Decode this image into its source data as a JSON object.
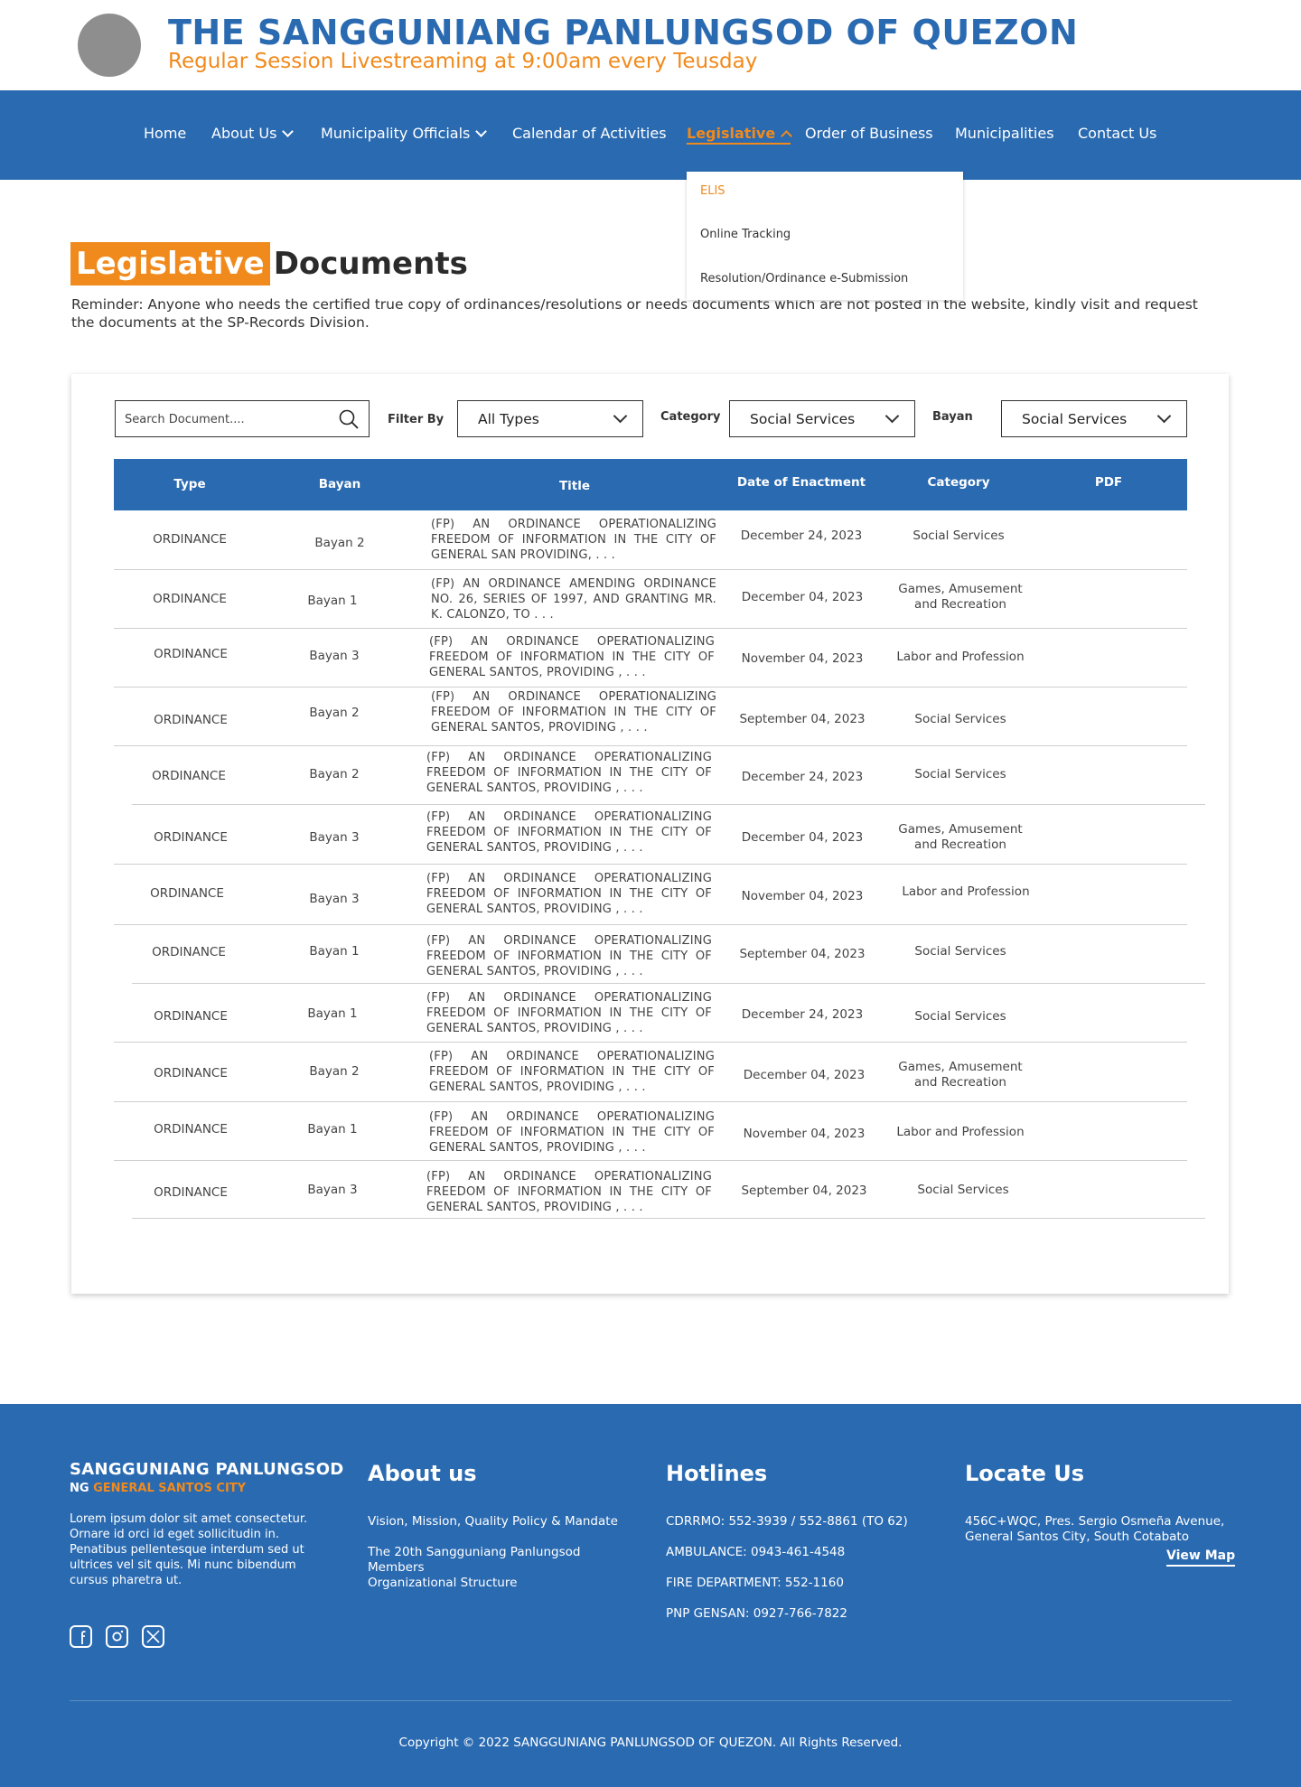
{
  "header": {
    "title": "THE SANGGUNIANG PANLUNGSOD OF QUEZON",
    "subtitle": "Regular Session Livestreaming at 9:00am every Teusday"
  },
  "nav": {
    "items": [
      "Home",
      "About Us",
      "Municipality Officials",
      "Calendar of Activities",
      "Legislative",
      "Order of Business",
      "Municipalities",
      "Contact Us"
    ],
    "active": "Legislative",
    "dropdown": [
      "ELIS",
      "Online Tracking",
      "Resolution/Ordinance e-Submission"
    ]
  },
  "page": {
    "title_highlight": "Legislative",
    "title_rest": "Documents",
    "reminder": "Reminder: Anyone who needs the certified true copy of ordinances/resolutions or needs documents which are not posted in the website, kindly visit and request the documents at the SP-Records Division."
  },
  "filters": {
    "search_placeholder": "Search Document....",
    "filter_by_label": "Filter By",
    "filter_by_value": "All Types",
    "category_label": "Category",
    "category_value": "Social Services",
    "bayan_label": "Bayan",
    "bayan_value": "Social Services"
  },
  "table": {
    "headers": [
      "Type",
      "Bayan",
      "Title",
      "Date of Enactment",
      "Category",
      "PDF"
    ],
    "rows": [
      {
        "type": "ORDINANCE",
        "bayan": "Bayan 2",
        "title": "(FP) AN ORDINANCE OPERATIONALIZING FREEDOM OF INFORMATION IN THE CITY OF GENERAL SAN PROVIDING, . . .",
        "date": "December 24, 2023",
        "category": "Social Services"
      },
      {
        "type": "ORDINANCE",
        "bayan": "Bayan 1",
        "title": "(FP) AN ORDINANCE AMENDING ORDINANCE NO. 26, SERIES OF 1997, AND GRANTING MR. K. CALONZO, TO . . .",
        "date": "December 04, 2023",
        "category": "Games, Amusement and Recreation"
      },
      {
        "type": "ORDINANCE",
        "bayan": "Bayan 3",
        "title": "(FP) AN ORDINANCE OPERATIONALIZING FREEDOM OF INFORMATION IN THE CITY OF GENERAL SANTOS, PROVIDING , . . .",
        "date": "November 04, 2023",
        "category": "Labor and Profession"
      },
      {
        "type": "ORDINANCE",
        "bayan": "Bayan 2",
        "title": "(FP) AN ORDINANCE OPERATIONALIZING FREEDOM OF INFORMATION IN THE CITY OF GENERAL SANTOS, PROVIDING , . . .",
        "date": "September 04, 2023",
        "category": "Social Services"
      },
      {
        "type": "ORDINANCE",
        "bayan": "Bayan 2",
        "title": "(FP) AN ORDINANCE OPERATIONALIZING FREEDOM OF INFORMATION IN THE CITY OF GENERAL SANTOS, PROVIDING , . . .",
        "date": "December 24, 2023",
        "category": "Social Services"
      },
      {
        "type": "ORDINANCE",
        "bayan": "Bayan 3",
        "title": "(FP) AN ORDINANCE OPERATIONALIZING FREEDOM OF INFORMATION IN THE CITY OF GENERAL SANTOS, PROVIDING , . . .",
        "date": "December 04, 2023",
        "category": "Games, Amusement and Recreation"
      },
      {
        "type": "ORDINANCE",
        "bayan": "Bayan 3",
        "title": "(FP) AN ORDINANCE OPERATIONALIZING FREEDOM OF INFORMATION IN THE CITY OF GENERAL SANTOS, PROVIDING , . . .",
        "date": "November 04, 2023",
        "category": "Labor and Profession"
      },
      {
        "type": "ORDINANCE",
        "bayan": "Bayan 1",
        "title": "(FP) AN ORDINANCE OPERATIONALIZING FREEDOM OF INFORMATION IN THE CITY OF GENERAL SANTOS, PROVIDING , . . .",
        "date": "September 04, 2023",
        "category": "Social Services"
      },
      {
        "type": "ORDINANCE",
        "bayan": "Bayan 1",
        "title": "(FP) AN ORDINANCE OPERATIONALIZING FREEDOM OF INFORMATION IN THE CITY OF GENERAL SANTOS, PROVIDING , . . .",
        "date": "December 24, 2023",
        "category": "Social Services"
      },
      {
        "type": "ORDINANCE",
        "bayan": "Bayan 2",
        "title": "(FP) AN ORDINANCE OPERATIONALIZING FREEDOM OF INFORMATION IN THE CITY OF GENERAL SANTOS, PROVIDING , . . .",
        "date": "December 04, 2023",
        "category": "Games, Amusement and Recreation"
      },
      {
        "type": "ORDINANCE",
        "bayan": "Bayan 1",
        "title": "(FP) AN ORDINANCE OPERATIONALIZING FREEDOM OF INFORMATION IN THE CITY OF GENERAL SANTOS, PROVIDING , . . .",
        "date": "November 04, 2023",
        "category": "Labor and Profession"
      },
      {
        "type": "ORDINANCE",
        "bayan": "Bayan 3",
        "title": "(FP) AN ORDINANCE OPERATIONALIZING FREEDOM OF INFORMATION IN THE CITY OF GENERAL SANTOS, PROVIDING , . . .",
        "date": "September 04, 2023",
        "category": "Social Services"
      }
    ]
  },
  "footer": {
    "brand_line1": "SANGGUNIANG PANLUNGSOD",
    "brand_ng": "NG",
    "brand_city": "GENERAL SANTOS CITY",
    "description": "Lorem ipsum dolor sit amet consectetur. Ornare id orci id eget sollicitudin in. Penatibus pellentesque interdum sed ut ultrices vel sit quis. Mi nunc bibendum cursus pharetra ut.",
    "social": [
      "facebook-icon",
      "instagram-icon",
      "x-icon"
    ],
    "about_heading": "About us",
    "about_links": [
      "Vision, Mission, Quality Policy & Mandate",
      "The 20th Sangguniang Panlungsod Members",
      "Organizational Structure"
    ],
    "hotlines_heading": "Hotlines",
    "hotlines": [
      "CDRRMO: 552-3939 / 552-8861 (TO 62)",
      "AMBULANCE: 0943-461-4548",
      "FIRE DEPARTMENT: 552-1160",
      "PNP GENSAN: 0927-766-7822"
    ],
    "locate_heading": "Locate Us",
    "address": "456C+WQC, Pres. Sergio Osmeña Avenue, General Santos City, South Cotabato",
    "view_map": "View Map",
    "copyright": "Copyright © 2022 SANGGUNIANG PANLUNGSOD OF QUEZON. All Rights Reserved."
  },
  "colors": {
    "brand_blue": "#2a6ab1",
    "accent_orange": "#f18a1c"
  }
}
